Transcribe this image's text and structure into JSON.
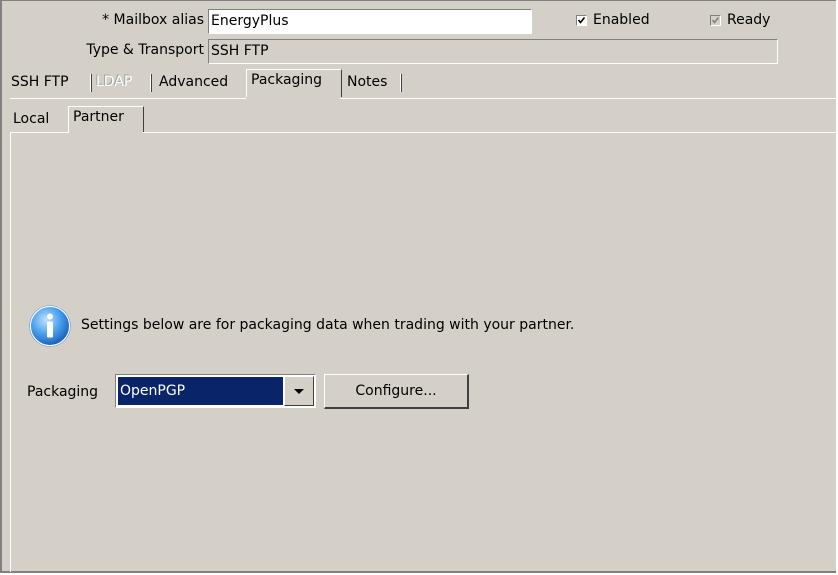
{
  "header": {
    "mailbox_alias_label": "* Mailbox alias",
    "mailbox_alias_value": "EnergyPlus",
    "type_transport_label": "Type & Transport",
    "type_transport_value": "SSH FTP",
    "enabled": {
      "label": "Enabled",
      "checked": true
    },
    "ready": {
      "label": "Ready",
      "checked": true,
      "disabled": true
    }
  },
  "main_tabs": [
    {
      "label": "SSH FTP",
      "selected": false,
      "disabled": false
    },
    {
      "label": "LDAP",
      "selected": false,
      "disabled": true
    },
    {
      "label": "Advanced",
      "selected": false,
      "disabled": false
    },
    {
      "label": "Packaging",
      "selected": true,
      "disabled": false
    },
    {
      "label": "Notes",
      "selected": false,
      "disabled": false
    }
  ],
  "sub_tabs": [
    {
      "label": "Local",
      "selected": false
    },
    {
      "label": "Partner",
      "selected": true
    }
  ],
  "content": {
    "info_icon": "info-icon",
    "info_text": "Settings below are for packaging data when trading with your partner.",
    "packaging_label": "Packaging",
    "packaging_value": "OpenPGP",
    "configure_label": "Configure..."
  },
  "colors": {
    "background": "#d4d0c8",
    "selection": "#0a246a",
    "info_icon": "#3a8ee6"
  }
}
